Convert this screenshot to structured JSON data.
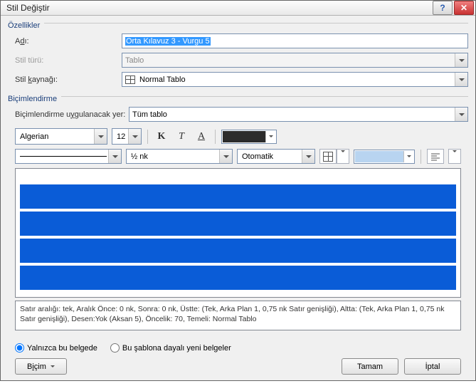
{
  "title": "Stil Değiştir",
  "groups": {
    "props": "Özellikler",
    "format": "Biçimlendirme"
  },
  "props": {
    "name_label_pre": "A",
    "name_label_ul": "d",
    "name_label_post": "ı:",
    "name_value": "Orta Kılavuz 3 - Vurgu 5",
    "type_label": "Stil türü:",
    "type_value": "Tablo",
    "based_label_pre": "Stil ",
    "based_label_ul": "k",
    "based_label_post": "aynağı:",
    "based_value": "Normal Tablo"
  },
  "format": {
    "apply_label_pre": "Biçimlendirme u",
    "apply_label_ul": "y",
    "apply_label_post": "gulanacak yer:",
    "apply_value": "Tüm tablo",
    "font_name": "Algerian",
    "font_size": "12",
    "bold": "K",
    "italic": "T",
    "underline": "A",
    "font_color": "#2c2c2c",
    "border_weight": "½ nk",
    "border_color_label": "Otomatik",
    "fill_color": "#b8d4f0",
    "cell_color": "#0a5cd7"
  },
  "description": "Satır aralığı:  tek, Aralık Önce:  0 nk, Sonra:  0 nk, Üstte: (Tek, Arka Plan 1,  0,75 nk Satır genişliği), Altta: (Tek, Arka Plan 1,  0,75 nk Satır genişliği), Desen:Yok (Aksan 5), Öncelik: 70, Temeli: Normal Tablo",
  "radios": {
    "doc": "Yalnızca bu belgede",
    "template": "Bu şablona dayalı yeni belgeler"
  },
  "buttons": {
    "format_pre": "B",
    "format_ul": "i",
    "format_post": "çim",
    "ok": "Tamam",
    "cancel": "İptal"
  }
}
